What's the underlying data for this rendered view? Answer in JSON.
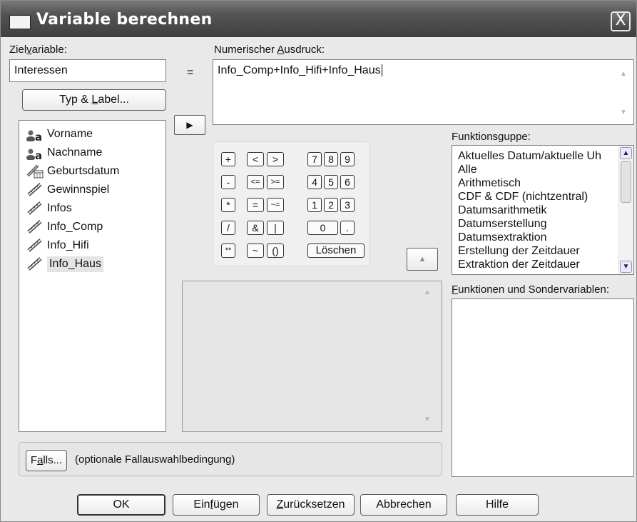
{
  "window": {
    "title": "Variable berechnen",
    "close_symbol": "X"
  },
  "target": {
    "label_pre": "Ziel",
    "label_acc": "v",
    "label_post": "ariable:",
    "value": "Interessen",
    "type_label_button_pre": "Typ & ",
    "type_label_button_acc": "L",
    "type_label_button_post": "abel..."
  },
  "equals": "=",
  "expression": {
    "label_pre": "Numerischer ",
    "label_acc": "A",
    "label_post": "usdruck:",
    "value": "Info_Comp+Info_Hifi+Info_Haus"
  },
  "variables": [
    {
      "name": "Vorname",
      "icon": "string-variable-icon"
    },
    {
      "name": "Nachname",
      "icon": "string-variable-icon"
    },
    {
      "name": "Geburtsdatum",
      "icon": "date-variable-icon"
    },
    {
      "name": "Gewinnspiel",
      "icon": "scale-variable-icon"
    },
    {
      "name": "Infos",
      "icon": "scale-variable-icon"
    },
    {
      "name": "Info_Comp",
      "icon": "scale-variable-icon"
    },
    {
      "name": "Info_Hifi",
      "icon": "scale-variable-icon"
    },
    {
      "name": "Info_Haus",
      "icon": "scale-variable-icon"
    }
  ],
  "move_button": "▶",
  "calculator": {
    "plus": "+",
    "lt": "<",
    "gt": ">",
    "n7": "7",
    "n8": "8",
    "n9": "9",
    "minus": "-",
    "le": "<=",
    "ge": ">=",
    "n4": "4",
    "n5": "5",
    "n6": "6",
    "mul": "*",
    "eq": "=",
    "ne": "~=",
    "n1": "1",
    "n2": "2",
    "n3": "3",
    "div": "/",
    "and": "&",
    "or": "|",
    "n0": "0",
    "dot": ".",
    "pow": "**",
    "not": "~",
    "paren": "()",
    "clear": "Löschen"
  },
  "up_button": "▲",
  "function_group": {
    "label_pre": "Funktions",
    "label_acc": "g",
    "label_post": "uppe:",
    "items": [
      "Aktuelles Datum/aktuelle Uh",
      "Alle",
      "Arithmetisch",
      "CDF & CDF (nichtzentral)",
      "Datumsarithmetik",
      "Datumserstellung",
      "Datumsextraktion",
      "Erstellung der Zeitdauer",
      "Extraktion der Zeitdauer"
    ]
  },
  "functions": {
    "label_pre": "",
    "label_acc": "F",
    "label_post": "unktionen und Sondervariablen:"
  },
  "if_button": {
    "pre": "F",
    "acc": "a",
    "post": "lls..."
  },
  "if_text": "(optionale Fallauswahlbedingung)",
  "footer": {
    "ok": "OK",
    "paste_pre": "Ein",
    "paste_acc": "f",
    "paste_post": "ügen",
    "reset_pre": "",
    "reset_acc": "Z",
    "reset_post": "urücksetzen",
    "cancel": "Abbrechen",
    "help": "Hilfe"
  }
}
